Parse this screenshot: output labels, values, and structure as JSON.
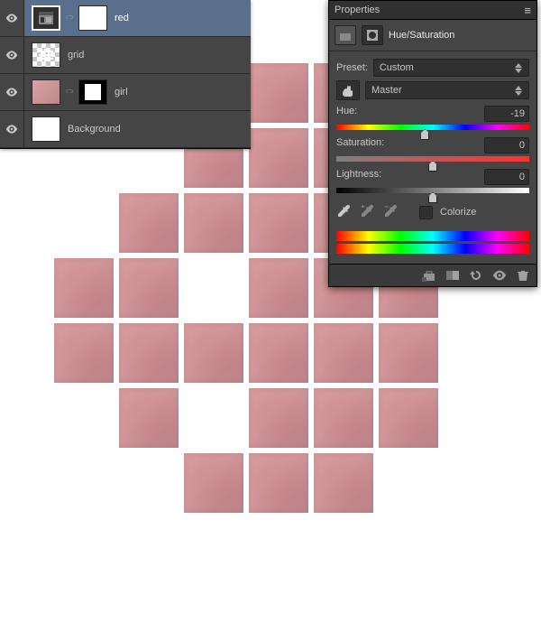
{
  "layers": {
    "items": [
      {
        "name": "red"
      },
      {
        "name": "grid"
      },
      {
        "name": "girl"
      },
      {
        "name": "Background"
      }
    ]
  },
  "properties": {
    "title": "Properties",
    "adjustment_name": "Hue/Saturation",
    "preset_label": "Preset:",
    "preset_value": "Custom",
    "channel_value": "Master",
    "hue": {
      "label": "Hue:",
      "value": "-19",
      "knob_pct": 46
    },
    "saturation": {
      "label": "Saturation:",
      "value": "0",
      "knob_pct": 50
    },
    "lightness": {
      "label": "Lightness:",
      "value": "0",
      "knob_pct": 50
    },
    "colorize_label": "Colorize"
  },
  "icons": {
    "menu": "≡"
  }
}
